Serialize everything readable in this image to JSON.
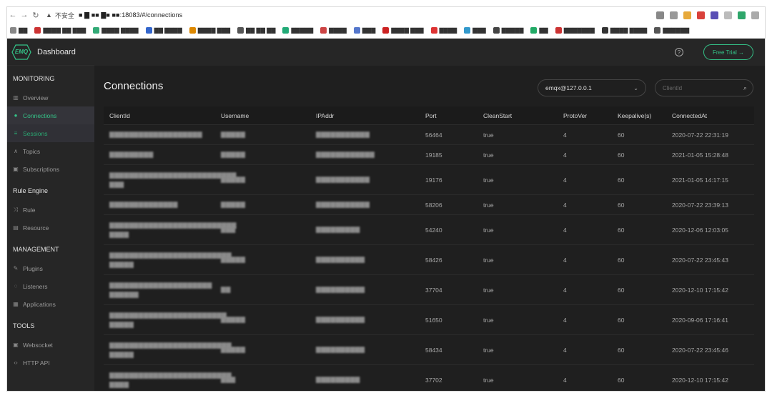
{
  "browser": {
    "insecure_label": "不安全",
    "url": "■ ▇ ■■ ▇■ ■■:18083/#/connections",
    "bookmarks": [
      "▇▇",
      "▇▇▇▇ ▇▇ ▇▇▇",
      "▇▇▇▇ ▇▇▇▇",
      "▇▇ ▇▇▇▇",
      "▇▇▇▇ ▇▇▇",
      "▇▇ ▇▇ ▇▇",
      "▇▇▇▇▇",
      "▇▇▇▇",
      "▇▇▇",
      "▇▇▇▇ ▇▇▇",
      "▇▇▇▇",
      "▇▇▇",
      "▇▇▇▇▇",
      "▇▇",
      "▇▇▇▇▇▇▇",
      "▇▇▇▇ ▇▇▇▇",
      "▇▇▇▇▇▇"
    ]
  },
  "app": {
    "logo_text": "EMQ",
    "title": "Dashboard",
    "free_trial": "Free Trial →"
  },
  "sidebar": {
    "sections": [
      {
        "title": "MONITORING",
        "items": [
          {
            "label": "Overview",
            "icon": "chart-icon"
          },
          {
            "label": "Connections",
            "icon": "connection-icon"
          },
          {
            "label": "Sessions",
            "icon": "sessions-icon"
          },
          {
            "label": "Topics",
            "icon": "topics-icon"
          },
          {
            "label": "Subscriptions",
            "icon": "subscriptions-icon"
          }
        ]
      },
      {
        "title": "Rule Engine",
        "items": [
          {
            "label": "Rule",
            "icon": "shuffle-icon"
          },
          {
            "label": "Resource",
            "icon": "resource-icon"
          }
        ]
      },
      {
        "title": "MANAGEMENT",
        "items": [
          {
            "label": "Plugins",
            "icon": "plugin-icon"
          },
          {
            "label": "Listeners",
            "icon": "listener-icon"
          },
          {
            "label": "Applications",
            "icon": "app-icon"
          }
        ]
      },
      {
        "title": "TOOLS",
        "items": [
          {
            "label": "Websocket",
            "icon": "websocket-icon"
          },
          {
            "label": "HTTP API",
            "icon": "code-icon"
          }
        ]
      }
    ]
  },
  "main": {
    "title": "Connections",
    "node": "emqx@127.0.0.1",
    "search_placeholder": "ClientId",
    "columns": [
      "ClientId",
      "Username",
      "IPAddr",
      "Port",
      "CleanStart",
      "ProtoVer",
      "Keepalive(s)",
      "ConnectedAt"
    ],
    "rows": [
      [
        "▇▇▇▇▇▇▇▇▇▇▇▇▇▇▇▇▇▇▇",
        "▇▇▇▇▇",
        "▇▇▇▇▇▇▇▇▇▇▇",
        "56464",
        "true",
        "4",
        "60",
        "2020-07-22 22:31:19"
      ],
      [
        "▇▇▇▇▇▇▇▇▇",
        "▇▇▇▇▇",
        "▇▇▇▇▇▇▇▇▇▇▇▇",
        "19185",
        "true",
        "4",
        "60",
        "2021-01-05 15:28:48"
      ],
      [
        "▇▇▇▇▇▇▇▇▇▇▇▇▇▇▇▇▇▇▇▇▇▇▇▇▇▇ ▇▇▇",
        "▇▇▇▇▇",
        "▇▇▇▇▇▇▇▇▇▇▇",
        "19176",
        "true",
        "4",
        "60",
        "2021-01-05 14:17:15"
      ],
      [
        "▇▇▇▇▇▇▇▇▇▇▇▇▇▇",
        "▇▇▇▇▇",
        "▇▇▇▇▇▇▇▇▇▇▇",
        "58206",
        "true",
        "4",
        "60",
        "2020-07-22 23:39:13"
      ],
      [
        "▇▇▇▇▇▇▇▇▇▇▇▇▇▇▇▇▇▇▇▇▇▇▇▇▇▇ ▇▇▇▇",
        "▇▇▇",
        "▇▇▇▇▇▇▇▇▇",
        "54240",
        "true",
        "4",
        "60",
        "2020-12-06 12:03:05"
      ],
      [
        "▇▇▇▇▇▇▇▇▇▇▇▇▇▇▇▇▇▇▇▇▇▇▇▇▇ ▇▇▇▇▇",
        "▇▇▇▇▇",
        "▇▇▇▇▇▇▇▇▇▇",
        "58426",
        "true",
        "4",
        "60",
        "2020-07-22 23:45:43"
      ],
      [
        "▇▇▇▇▇▇▇▇▇▇▇▇▇▇▇▇▇▇▇▇▇ ▇▇▇▇▇▇",
        "▇▇",
        "▇▇▇▇▇▇▇▇▇▇",
        "37704",
        "true",
        "4",
        "60",
        "2020-12-10 17:15:42"
      ],
      [
        "▇▇▇▇▇▇▇▇▇▇▇▇▇▇▇▇▇▇▇▇▇▇▇▇ ▇▇▇▇▇",
        "▇▇▇▇▇",
        "▇▇▇▇▇▇▇▇▇▇",
        "51650",
        "true",
        "4",
        "60",
        "2020-09-06 17:16:41"
      ],
      [
        "▇▇▇▇▇▇▇▇▇▇▇▇▇▇▇▇▇▇▇▇▇▇▇▇▇ ▇▇▇▇▇",
        "▇▇▇▇▇",
        "▇▇▇▇▇▇▇▇▇▇",
        "58434",
        "true",
        "4",
        "60",
        "2020-07-22 23:45:46"
      ],
      [
        "▇▇▇▇▇▇▇▇▇▇▇▇▇▇▇▇▇▇▇▇▇▇▇▇▇ ▇▇▇▇",
        "▇▇▇",
        "▇▇▇▇▇▇▇▇▇",
        "37702",
        "true",
        "4",
        "60",
        "2020-12-10 17:15:42"
      ]
    ]
  },
  "colors": {
    "accent": "#34c388",
    "sidebar_bg": "#262626",
    "content_bg": "#1f1f1f"
  }
}
